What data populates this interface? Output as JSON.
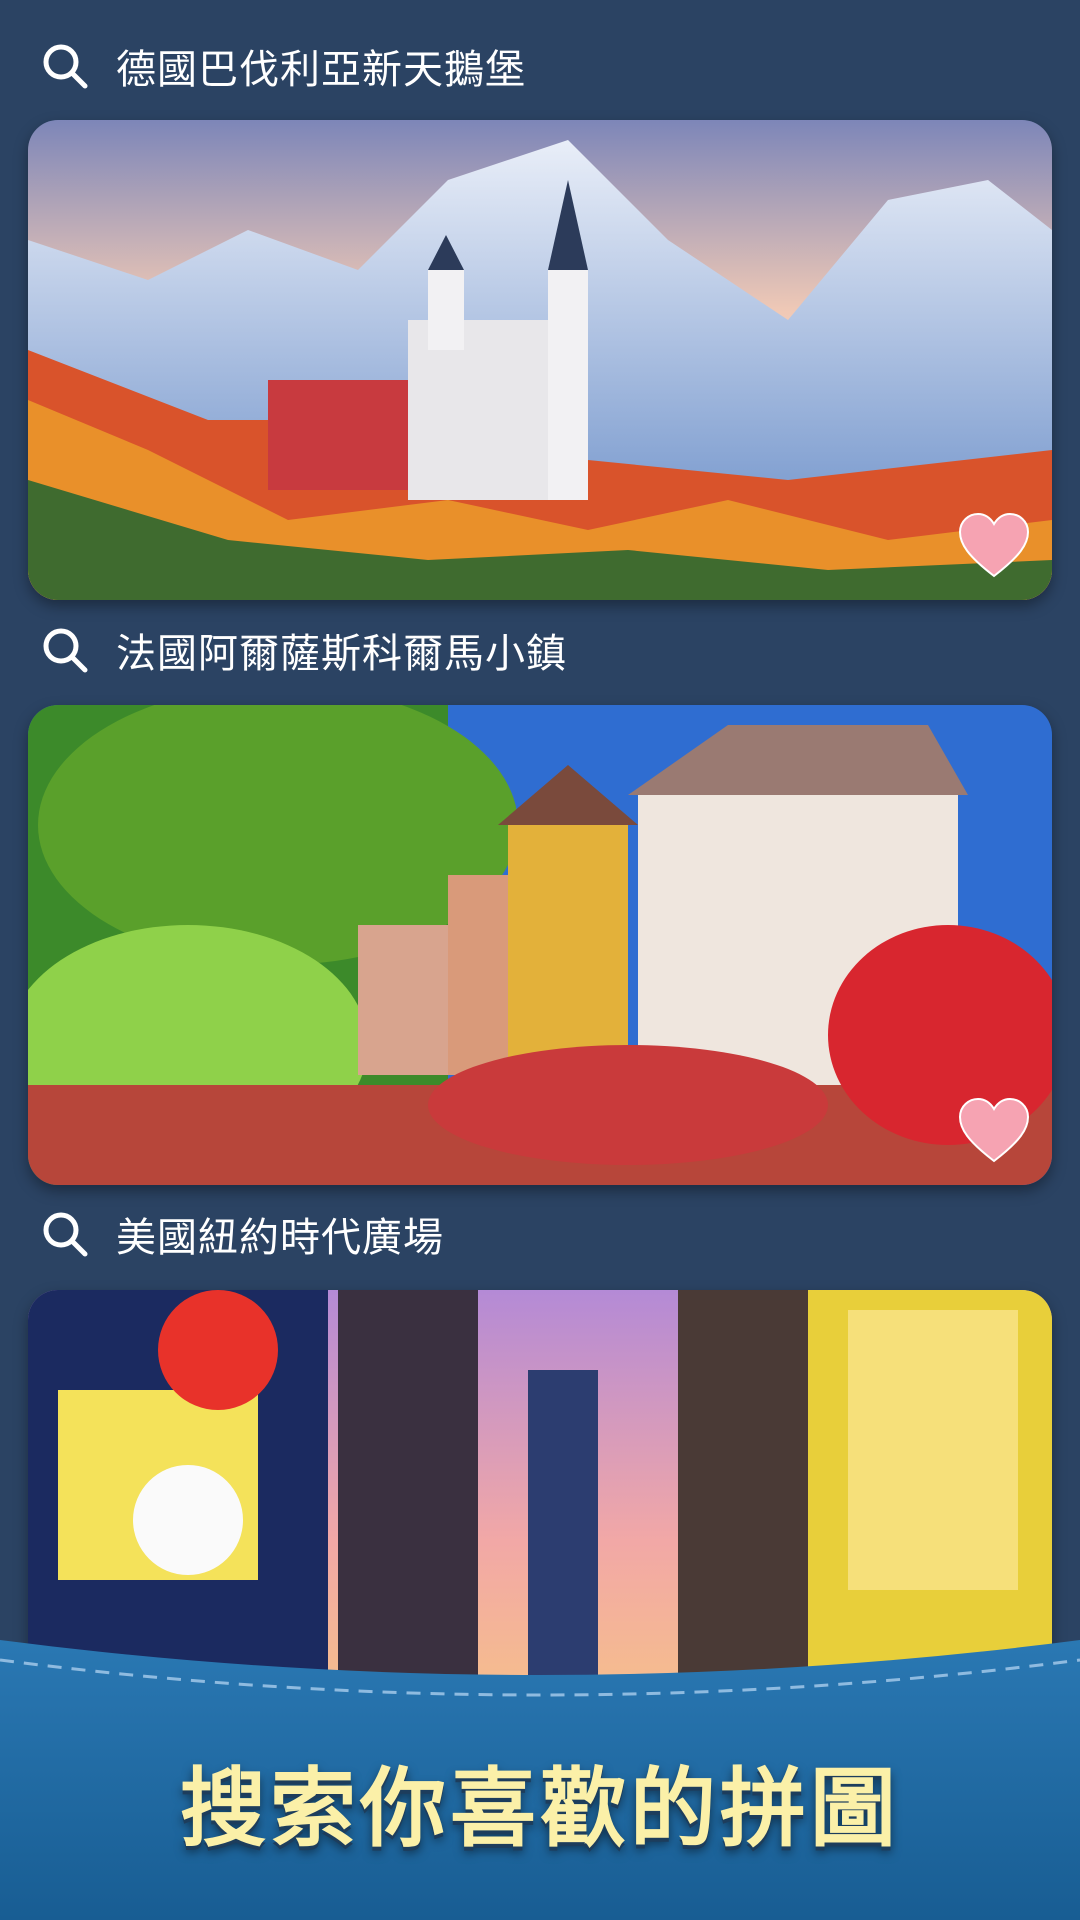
{
  "items": [
    {
      "title": "德國巴伐利亞新天鵝堡",
      "favorited": true,
      "icon": "search-icon"
    },
    {
      "title": "法國阿爾薩斯科爾馬小鎮",
      "favorited": true,
      "icon": "search-icon"
    },
    {
      "title": "美國紐約時代廣場",
      "favorited": false,
      "icon": "search-icon"
    }
  ],
  "banner": {
    "title": "搜索你喜歡的拼圖"
  },
  "colors": {
    "background": "#2b4363",
    "heart": "#f6a3b2",
    "banner_text": "#fbf0a8",
    "banner_bg": "#1f6a9e"
  }
}
